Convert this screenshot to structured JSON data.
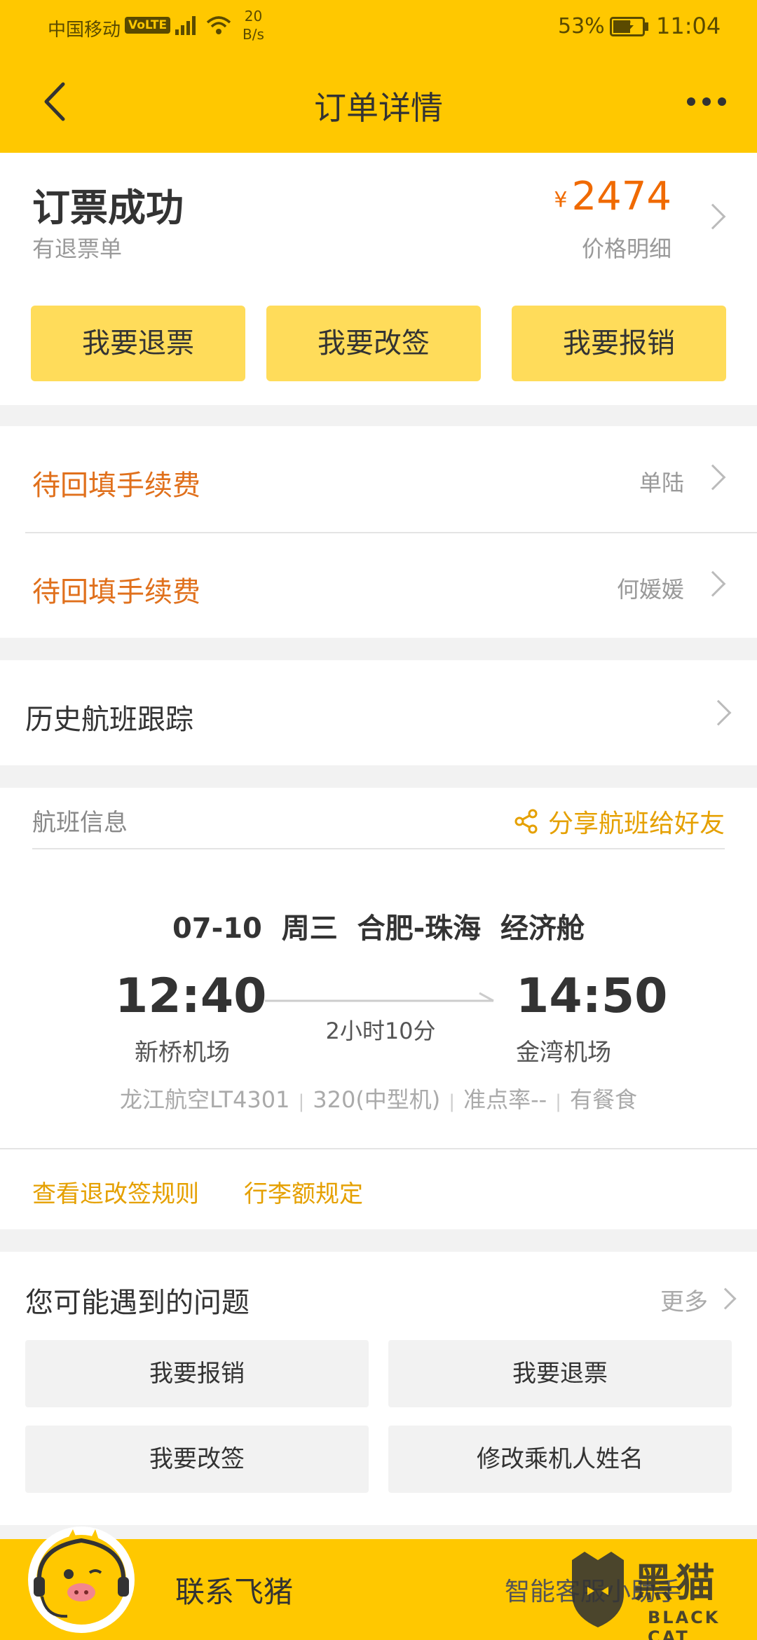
{
  "status_bar": {
    "carrier": "中国移动",
    "volte": "VoLTE",
    "speed_top": "20",
    "speed_bottom": "B/s",
    "battery_pct": "53%",
    "time": "11:04"
  },
  "nav": {
    "title": "订单详情",
    "back_icon": "back-chevron-icon",
    "more_icon": "more-dots-icon"
  },
  "order": {
    "status": "订票成功",
    "sub_status": "有退票单",
    "currency": "¥",
    "price": "2474",
    "price_detail": "价格明细",
    "actions": [
      "我要退票",
      "我要改签",
      "我要报销"
    ]
  },
  "fees": [
    {
      "label": "待回填手续费",
      "name": "单陆"
    },
    {
      "label": "待回填手续费",
      "name": "何媛媛"
    }
  ],
  "history": {
    "label": "历史航班跟踪"
  },
  "flight": {
    "section_label": "航班信息",
    "share_label": "分享航班给好友",
    "route": "07-10  周三  合肥-珠海  经济舱",
    "departure_time": "12:40",
    "arrival_time": "14:50",
    "duration": "2小时10分",
    "departure_airport": "新桥机场",
    "arrival_airport": "金湾机场",
    "meta": [
      "龙江航空LT4301",
      "320(中型机)",
      "准点率--",
      "有餐食"
    ],
    "links": [
      "查看退改签规则",
      "行李额规定"
    ]
  },
  "faq": {
    "title": "您可能遇到的问题",
    "more": "更多",
    "items": [
      "我要报销",
      "我要退票",
      "我要改签",
      "修改乘机人姓名"
    ]
  },
  "bottom": {
    "contact": "联系飞猪",
    "assistant": "智能客服小助手"
  },
  "watermark": {
    "text": "黑猫",
    "sub": "BLACK CAT"
  },
  "colors": {
    "brand_yellow": "#ffc800",
    "button_yellow": "#ffdc5a",
    "price_orange": "#f06a00",
    "fee_orange": "#e0701c",
    "link_gold": "#e5a000"
  }
}
